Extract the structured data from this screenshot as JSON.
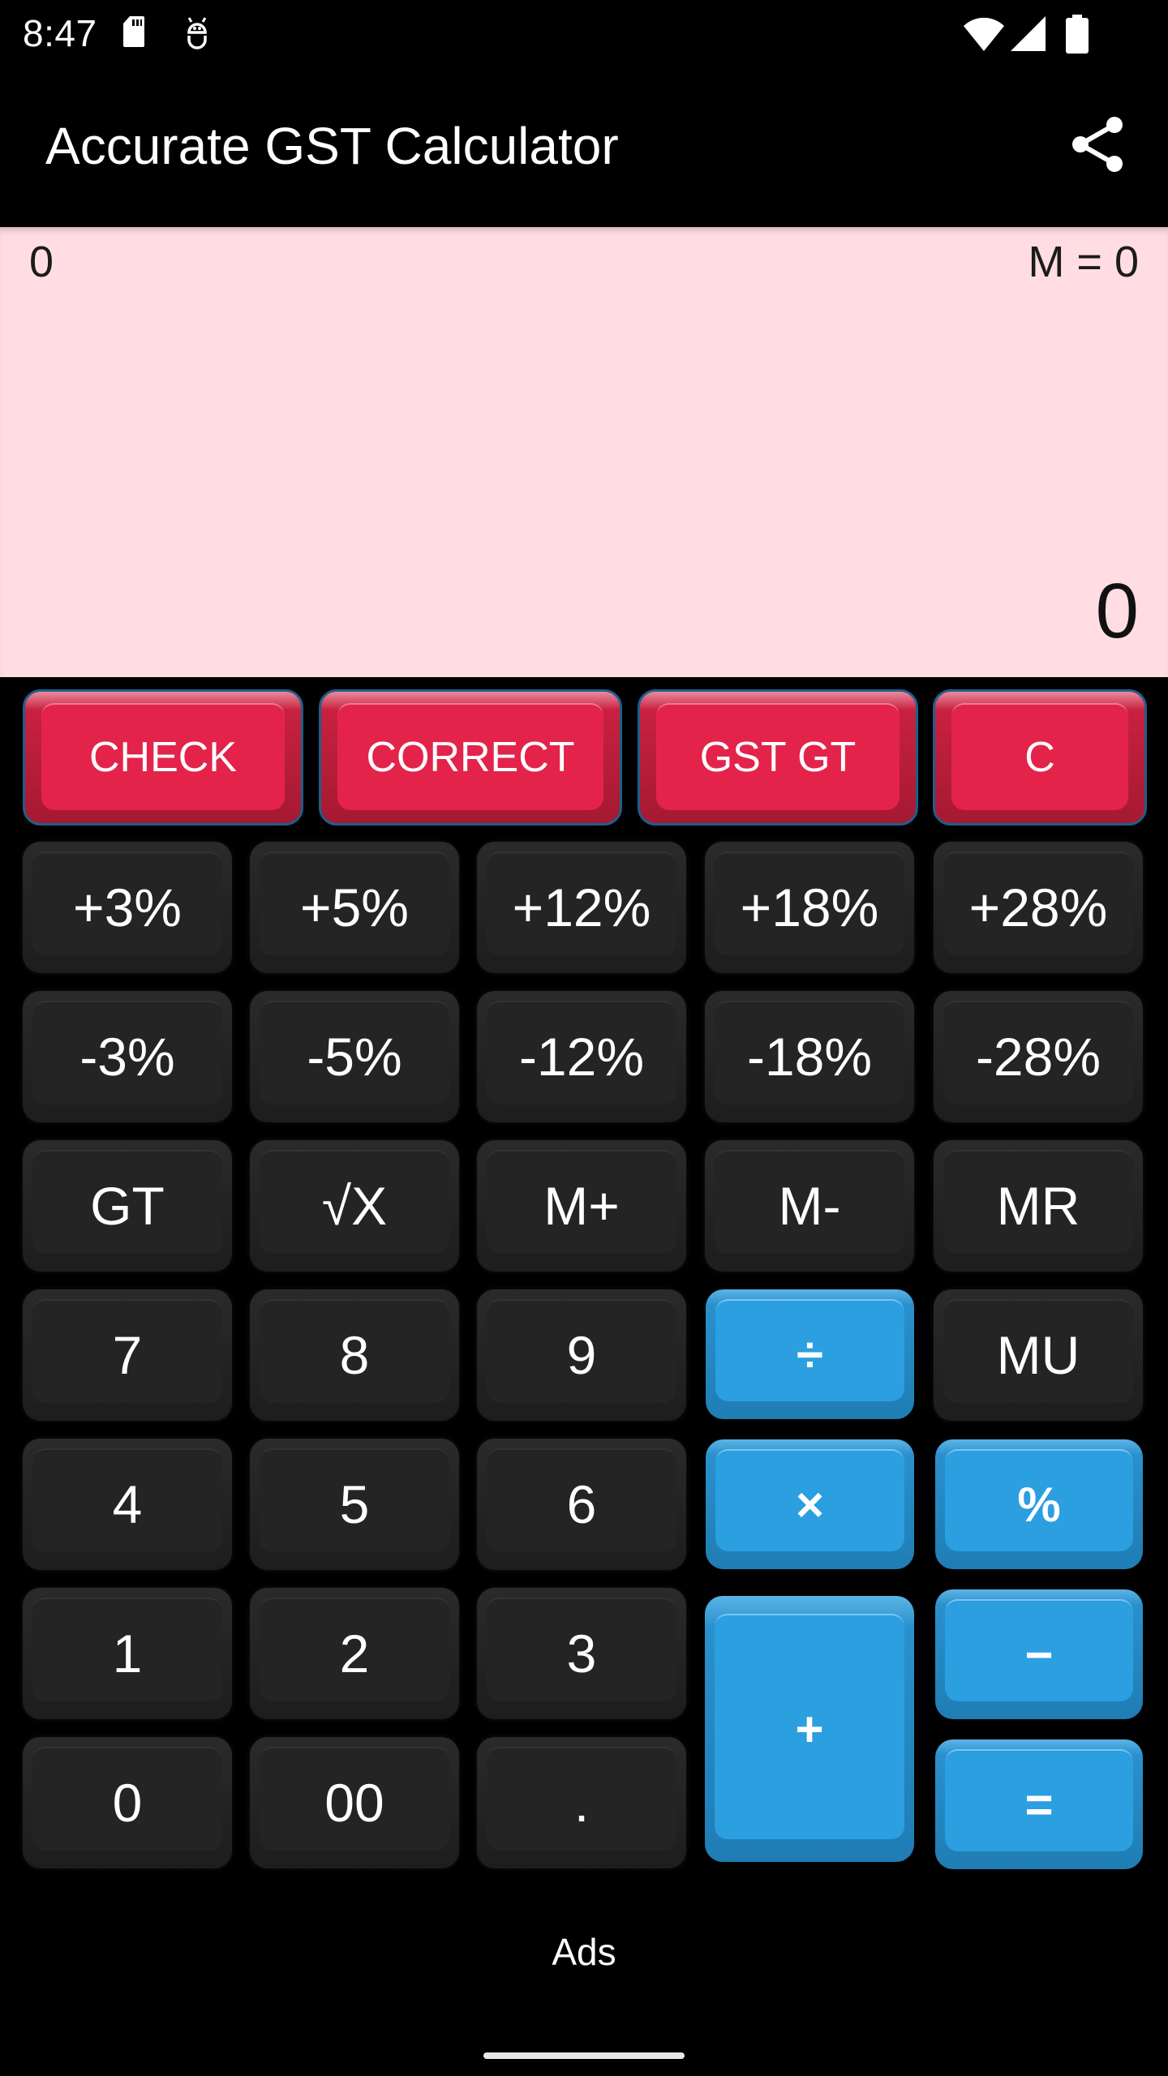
{
  "status_bar": {
    "time": "8:47",
    "left_icons": [
      "sd-card-icon",
      "vpn-bot-icon"
    ],
    "right_icons": [
      "wifi-icon",
      "signal-icon",
      "battery-icon"
    ]
  },
  "app_bar": {
    "title": "Accurate GST Calculator",
    "share_icon": "share-icon"
  },
  "display": {
    "secondary_value": "0",
    "memory": "M = 0",
    "main_value": "0",
    "background": "#FFDDE3"
  },
  "colors": {
    "red_key": "#E4234A",
    "blue_key": "#2B9FE0",
    "dark_key": "#242424"
  },
  "top_row": [
    {
      "label": "CHECK"
    },
    {
      "label": "CORRECT"
    },
    {
      "label": "GST GT"
    },
    {
      "label": "C"
    }
  ],
  "keypad": {
    "gst_add": [
      "+3%",
      "+5%",
      "+12%",
      "+18%",
      "+28%"
    ],
    "gst_sub": [
      "-3%",
      "-5%",
      "-12%",
      "-18%",
      "-28%"
    ],
    "memory_row": [
      "GT",
      "√X",
      "M+",
      "M-",
      "MR"
    ],
    "row_789": [
      "7",
      "8",
      "9",
      "÷",
      "MU"
    ],
    "row_456": [
      "4",
      "5",
      "6",
      "×",
      "%"
    ],
    "row_123": [
      "1",
      "2",
      "3",
      "+",
      "−"
    ],
    "row_0": [
      "0",
      "00",
      ".",
      "="
    ]
  },
  "footer": {
    "ads_label": "Ads"
  }
}
